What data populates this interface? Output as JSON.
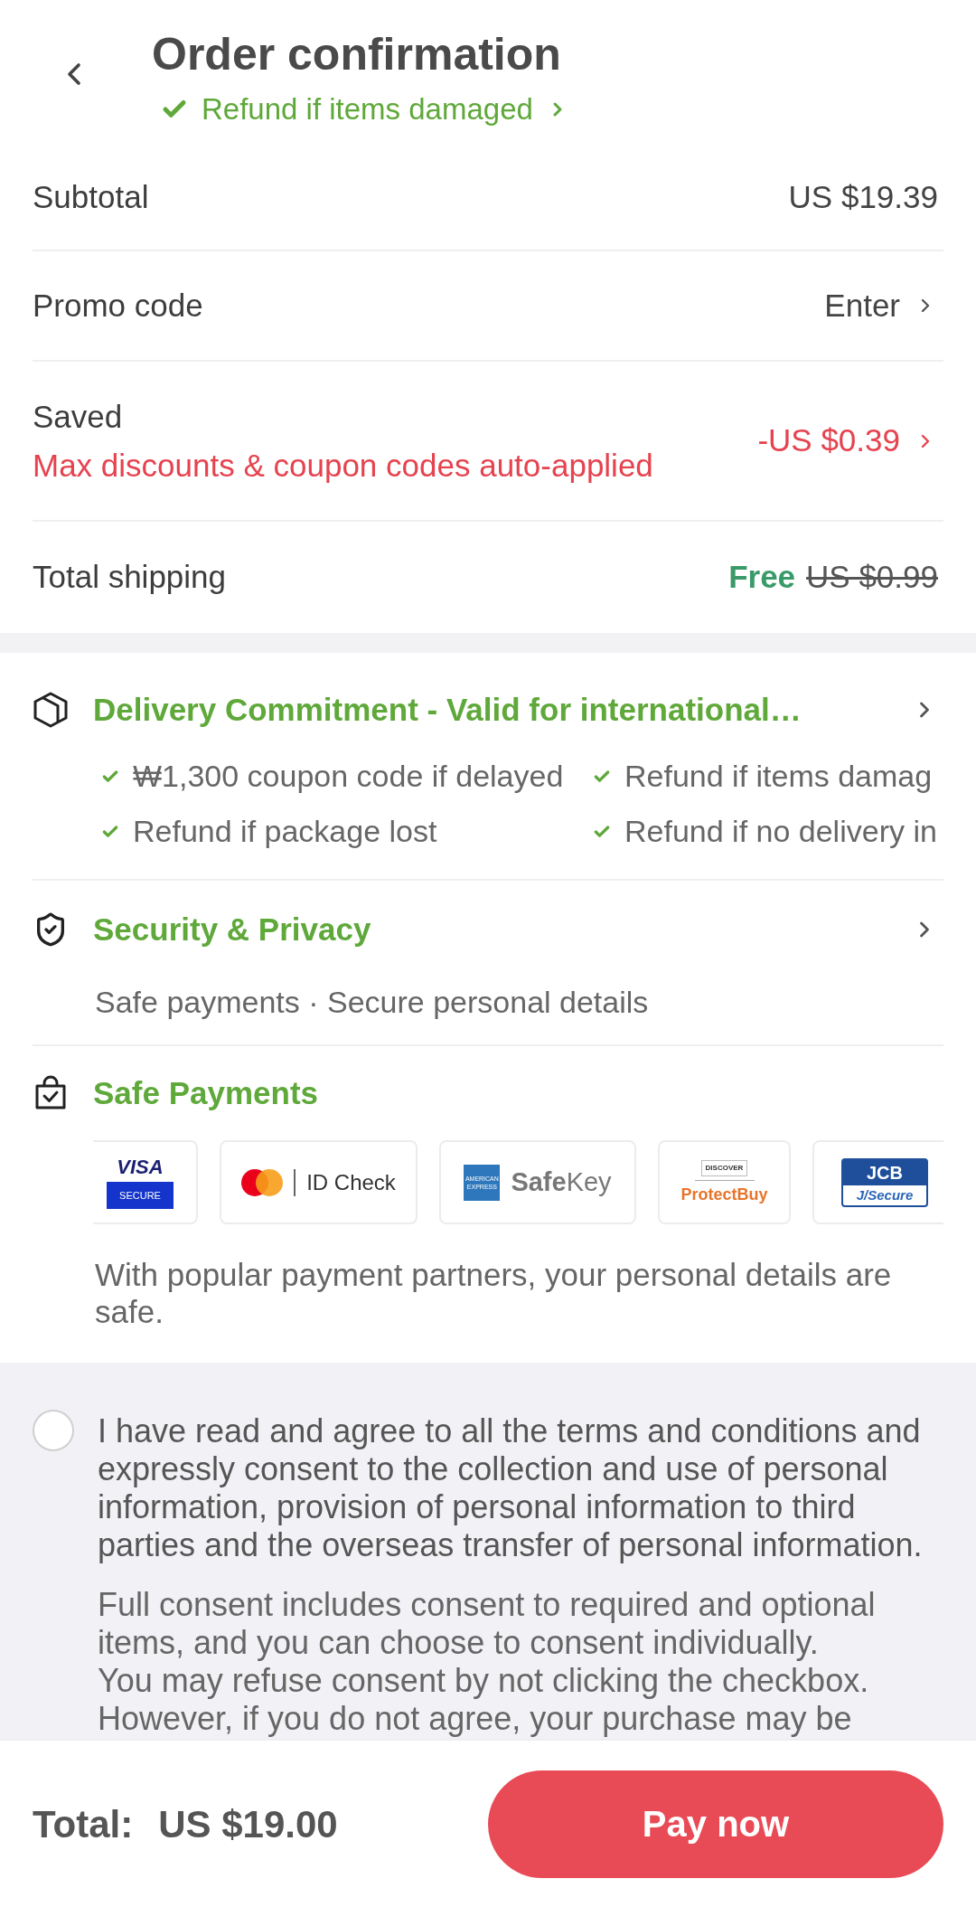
{
  "header": {
    "title": "Order confirmation",
    "guarantee": "Refund if items damaged"
  },
  "summary_rows": [
    {
      "kind": "amount",
      "label": "Subtotal",
      "value": "US $19.39"
    },
    {
      "kind": "link",
      "label": "Promo code",
      "value": "Enter"
    },
    {
      "kind": "discount",
      "label": "Saved",
      "note": "Max discounts & coupon codes auto-applied",
      "value": "-US $0.39"
    },
    {
      "kind": "shipping",
      "label": "Total shipping",
      "value": "Free",
      "original_price": "US $0.99"
    }
  ],
  "delivery_commitment": {
    "title": "Delivery Commitment - Valid for international…",
    "items": [
      "₩1,300 coupon code if delayed",
      "Refund if items damag",
      "Refund if package lost",
      "Refund if no delivery in"
    ]
  },
  "security": {
    "title": "Security & Privacy",
    "subtitle": "Safe payments · Secure personal details"
  },
  "safe_payments": {
    "title": "Safe Payments",
    "partners": [
      {
        "kind": "visa",
        "texts": [
          "VISA",
          "SECURE"
        ]
      },
      {
        "kind": "mastercard",
        "texts": [
          "ID Check"
        ]
      },
      {
        "kind": "amex",
        "texts": [
          "AMERICAN EXPRESS",
          "**Safe**Key"
        ]
      },
      {
        "kind": "discover",
        "texts": [
          "DISCOVER",
          "ProtectBuy"
        ]
      },
      {
        "kind": "jcb",
        "texts": [
          "JCB",
          "J/Secure"
        ]
      }
    ],
    "note": "With popular payment partners, your personal details are safe."
  },
  "consent": {
    "checked": false,
    "statement": "I have read and agree to all the terms and conditions and expressly consent to the collection and use of personal information, provision of personal information to third parties and the overseas transfer of personal information.",
    "details": [
      "Full consent includes consent to required and optional items, and you can choose to consent individually.",
      "You may refuse consent by not clicking the checkbox. However, if you do not agree, your purchase may be"
    ]
  },
  "footer": {
    "total_label": "Total:",
    "total": "US $19.00",
    "button": "Pay now"
  }
}
